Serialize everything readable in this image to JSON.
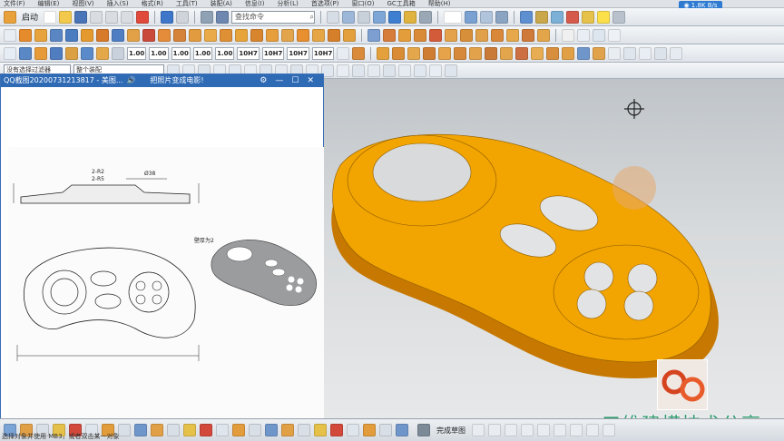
{
  "menubar": {
    "items": [
      "文件(F)",
      "编辑(E)",
      "视图(V)",
      "插入(S)",
      "格式(R)",
      "工具(T)",
      "装配(A)",
      "信息(I)",
      "分析(L)",
      "首选项(P)",
      "窗口(O)",
      "GC工具箱",
      "帮助(H)"
    ]
  },
  "toolbar1": {
    "start_label": "启动",
    "search_placeholder": "查找命令",
    "speed_badge": "◉ 1.8K B/s"
  },
  "toolbar3": {
    "precision_buttons": [
      "1.00",
      "1.00",
      "1.00",
      "1.00",
      "1.00",
      "10H7",
      "10H7",
      "10H7",
      "10H7"
    ]
  },
  "toolbar4": {
    "filter_select": "没有选择过滤器",
    "scope_select": "整个装配"
  },
  "popup": {
    "title": "QQ截图20200731213817 - 美图...",
    "subtitle": "把照片变成电影!",
    "drawing_note": "壁厚为2",
    "drawing_dims": [
      "2-R2",
      "2-R5",
      "Ø38"
    ]
  },
  "bottombar": {
    "label": "完成草图",
    "status": "选择对象并使用 MB3，或者双击某一对象"
  },
  "watermark": "三维建模技术分享",
  "colors": {
    "part": "#f2a400",
    "part_shadow": "#c67800",
    "title_bar": "#2f6ab5",
    "watermark": "#2e9b6e"
  }
}
